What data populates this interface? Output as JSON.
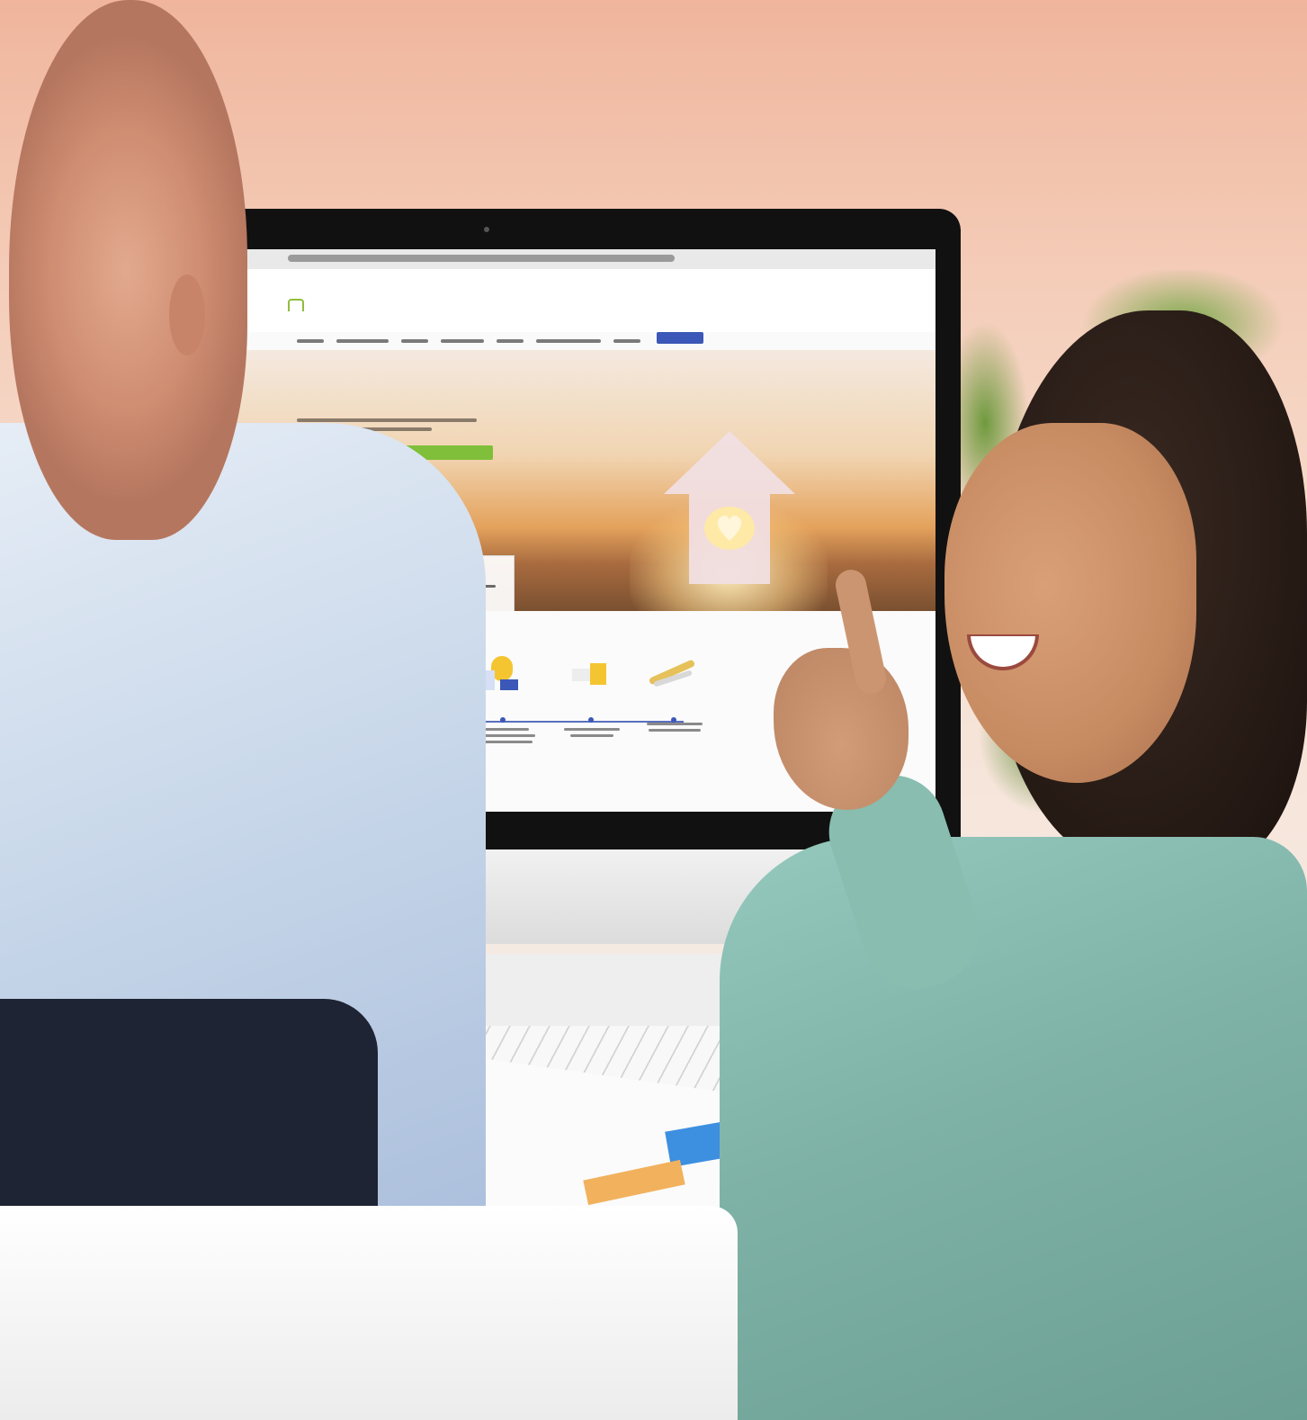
{
  "scene": {
    "colors": {
      "wall_top": "#f0b59c",
      "shirt": "#c9d8ea",
      "sweater": "#7fb2a6",
      "hero_sunset": "#e4a25c",
      "brand_blue": "#3b57b8",
      "brand_green": "#8fbe3b"
    }
  },
  "screen": {
    "nav_items": [
      "",
      "",
      "",
      "",
      "",
      "",
      ""
    ],
    "steps": [
      {
        "icon": "computer-icon"
      },
      {
        "icon": "documents-icon"
      },
      {
        "icon": "checklist-icon"
      },
      {
        "icon": "folder-icon"
      },
      {
        "icon": "handshake-icon"
      }
    ]
  }
}
